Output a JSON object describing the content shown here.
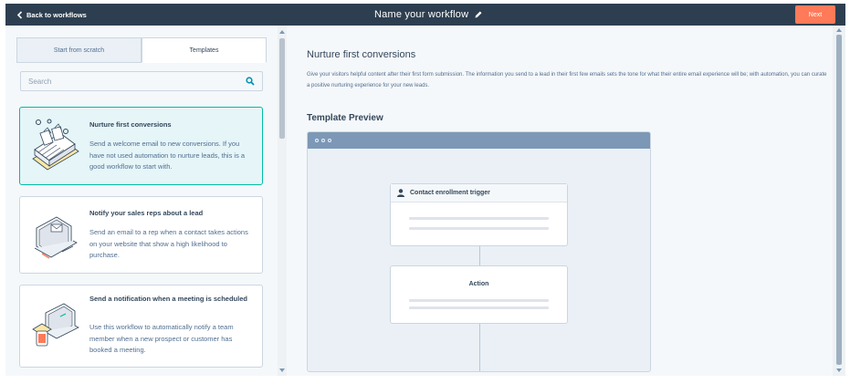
{
  "topbar": {
    "back_label": "Back to workflows",
    "workflow_name": "Name your workflow",
    "next_label": "Next"
  },
  "tabs": [
    {
      "label": "Start from scratch",
      "active": false
    },
    {
      "label": "Templates",
      "active": true
    }
  ],
  "search": {
    "placeholder": "Search"
  },
  "templates": [
    {
      "title": "Nurture first conversions",
      "description": "Send a welcome email to new conversions. If you have not used automation to nurture leads, this is a good workflow to start with.",
      "selected": true,
      "icon": "conveyor-icon"
    },
    {
      "title": "Notify your sales reps about a lead",
      "description": "Send an email to a rep when a contact takes actions on your website that show a high likelihood to purchase.",
      "selected": false,
      "icon": "laptop-email-icon"
    },
    {
      "title": "Send a notification when a meeting is scheduled",
      "description": "Use this workflow to automatically notify a team member when a new prospect or customer has booked a meeting.",
      "selected": false,
      "icon": "laptop-phone-icon"
    }
  ],
  "detail": {
    "title": "Nurture first conversions",
    "description": "Give your visitors helpful content after their first form submission. The information you send to a lead in their first few emails sets the tone for what their entire email experience will be; with automation, you can curate a positive nurturing experience for your new leads.",
    "preview_label": "Template Preview"
  },
  "preview": {
    "trigger_label": "Contact enrollment trigger",
    "action_label": "Action"
  },
  "colors": {
    "topbar": "#2d3e50",
    "accent": "#ff7a59",
    "selected_border": "#00bda5",
    "selected_bg": "#e5f5f8"
  }
}
